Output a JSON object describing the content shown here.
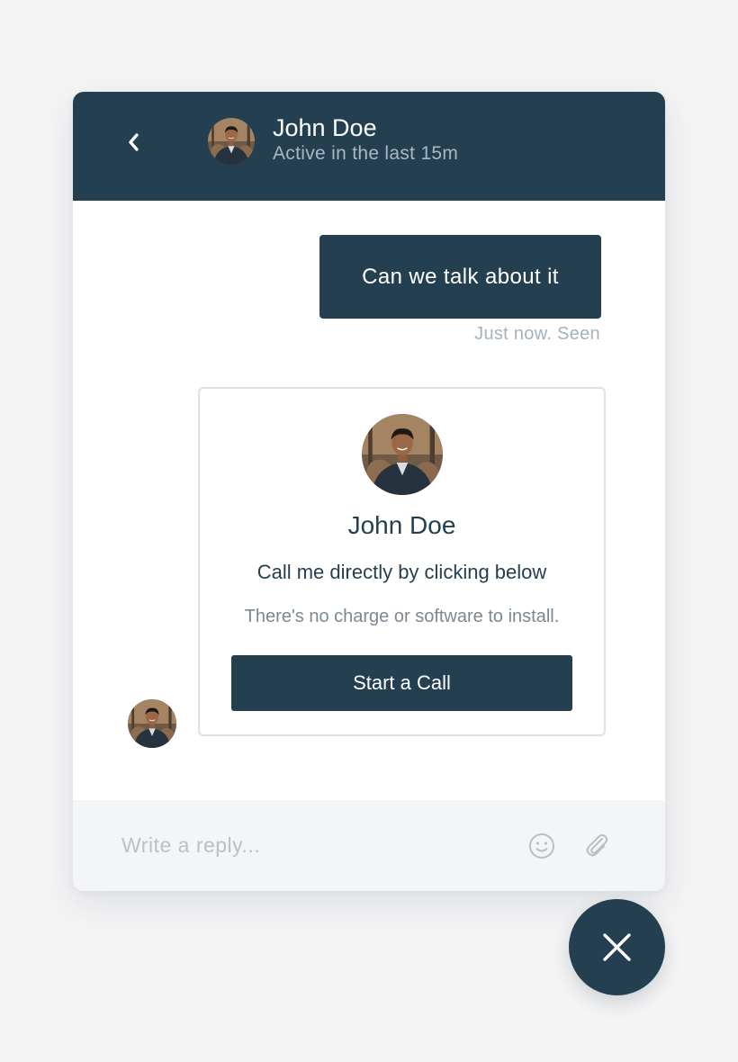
{
  "header": {
    "name": "John Doe",
    "status": "Active in the last 15m"
  },
  "messages": {
    "outgoing_text": "Can we talk about it",
    "outgoing_meta": "Just now. Seen"
  },
  "call_card": {
    "name": "John Doe",
    "title": "Call me directly by clicking below",
    "subtitle": "There's no charge or software to install.",
    "button_label": "Start a Call"
  },
  "composer": {
    "placeholder": "Write a reply..."
  },
  "icons": {
    "back": "chevron-left-icon",
    "emoji": "smiley-icon",
    "attach": "paperclip-icon",
    "close": "close-icon"
  },
  "colors": {
    "brand": "#243f50",
    "page_background": "#f4f4f5",
    "muted_text": "#a6b1ba"
  }
}
